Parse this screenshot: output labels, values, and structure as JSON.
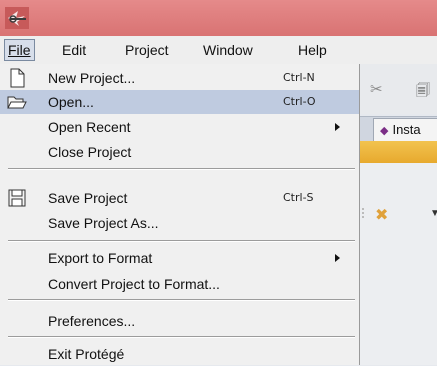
{
  "menubar": {
    "items": [
      {
        "label": "File",
        "mnemonic_index": 0
      },
      {
        "label": "Edit",
        "mnemonic_index": 0
      },
      {
        "label": "Project",
        "mnemonic_index": 0
      },
      {
        "label": "Window",
        "mnemonic_index": 0
      },
      {
        "label": "Help",
        "mnemonic_index": 0
      }
    ],
    "active": "File"
  },
  "file_menu": {
    "items": [
      {
        "label": "New Project...",
        "shortcut": "Ctrl-N",
        "icon": "new-document-icon"
      },
      {
        "label": "Open...",
        "shortcut": "Ctrl-O",
        "icon": "open-folder-icon",
        "highlighted": true
      },
      {
        "label": "Open Recent",
        "submenu": true
      },
      {
        "label": "Close Project"
      },
      {
        "label": "Save Project",
        "shortcut": "Ctrl-S",
        "icon": "save-disk-icon"
      },
      {
        "label": "Save Project As..."
      },
      {
        "label": "Export to Format",
        "submenu": true
      },
      {
        "label": "Convert Project to Format..."
      },
      {
        "label": "Preferences..."
      },
      {
        "label": "Exit Protégé"
      }
    ]
  },
  "background": {
    "tab_label": "Insta"
  },
  "colors": {
    "title_bar": "#d97373",
    "highlight": "#bfcbe0",
    "orange_bar": "#e7a92e",
    "tab_diamond": "#7b2e86"
  }
}
